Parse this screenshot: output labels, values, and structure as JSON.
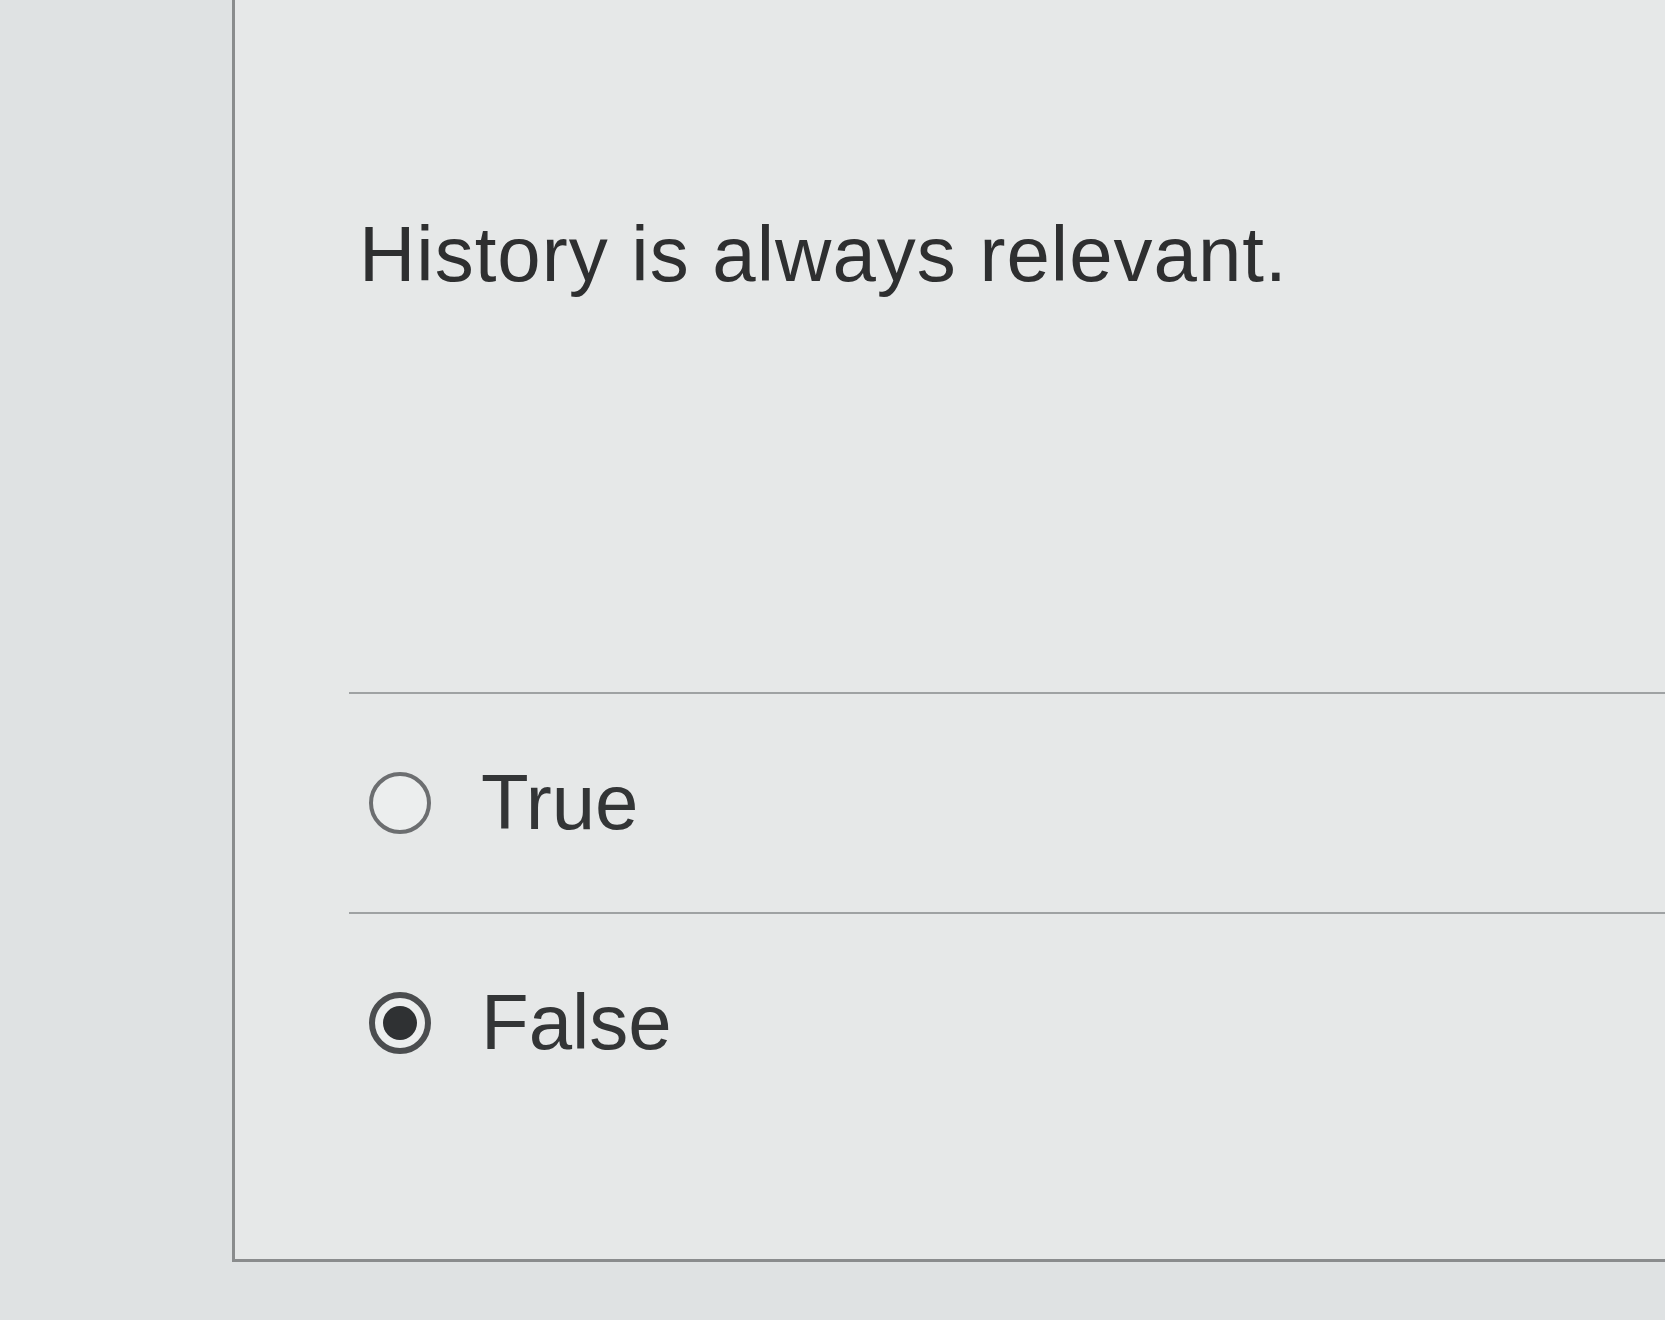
{
  "question": {
    "text": "History is always relevant."
  },
  "options": [
    {
      "label": "True",
      "selected": false
    },
    {
      "label": "False",
      "selected": true
    }
  ]
}
